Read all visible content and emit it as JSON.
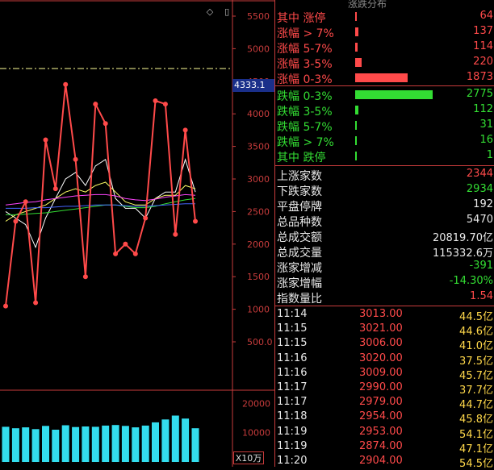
{
  "chart": {
    "price_axis": [
      "5500",
      "5000",
      "4500",
      "4000",
      "3500",
      "3000",
      "2500",
      "2000",
      "1500",
      "1000",
      "500.0"
    ],
    "volume_axis": [
      "20000",
      "10000"
    ],
    "current_price": "4333.1",
    "volume_unit": "X10万",
    "colors": {
      "up": "#ff4a4a",
      "axis": "#c83c3c",
      "ma5": "#ffffff",
      "ma10": "#ffff66",
      "ma20": "#ff44ff",
      "ma30": "#33dd33",
      "ma60": "#4466ff",
      "volume": "#33ddee"
    }
  },
  "chart_data": {
    "type": "line",
    "title": "",
    "ylabel": "",
    "ylim": [
      300,
      5700
    ],
    "series": [
      {
        "values": [
          1050,
          2350,
          2650,
          1100,
          3600,
          2850,
          4450,
          3300,
          1500,
          4150,
          3850,
          1850,
          2000,
          1850,
          2400,
          4200,
          4150,
          2150,
          3750,
          2350
        ]
      },
      {
        "values": [
          2500,
          2400,
          2300,
          1950,
          2400,
          2700,
          3000,
          3100,
          2900,
          3200,
          3300,
          2700,
          2550,
          2550,
          2400,
          2700,
          2800,
          2800,
          3300,
          2800
        ]
      },
      {
        "values": [
          2350,
          2450,
          2500,
          2550,
          2600,
          2700,
          2800,
          2850,
          2800,
          2900,
          2950,
          2800,
          2650,
          2600,
          2600,
          2700,
          2750,
          2750,
          2900,
          2850
        ]
      },
      {
        "values": [
          2600,
          2620,
          2640,
          2650,
          2680,
          2700,
          2720,
          2740,
          2750,
          2760,
          2760,
          2740,
          2700,
          2680,
          2670,
          2690,
          2720,
          2740,
          2760,
          2750
        ]
      },
      {
        "values": [
          2450,
          2450,
          2460,
          2470,
          2480,
          2500,
          2520,
          2540,
          2560,
          2580,
          2600,
          2600,
          2580,
          2560,
          2560,
          2580,
          2620,
          2650,
          2680,
          2700
        ]
      },
      {
        "values": [
          2550,
          2550,
          2550,
          2560,
          2560,
          2570,
          2580,
          2580,
          2590,
          2600,
          2600,
          2600,
          2590,
          2580,
          2580,
          2590,
          2600,
          2610,
          2620,
          2620
        ]
      }
    ],
    "volume": [
      12000,
      11500,
      11800,
      11200,
      12300,
      11000,
      12500,
      11900,
      12100,
      12000,
      12400,
      12600,
      12300,
      11800,
      12400,
      13500,
      14500,
      15800,
      14800,
      11500
    ]
  },
  "stats": {
    "header": "涨跌分布",
    "dist": [
      {
        "label": "其中 涨停",
        "value": "64",
        "color": "#ff4a4a",
        "frac": 0.02
      },
      {
        "label": "涨幅 > 7%",
        "value": "137",
        "color": "#ff4a4a",
        "frac": 0.04
      },
      {
        "label": "涨幅 5-7%",
        "value": "114",
        "color": "#ff4a4a",
        "frac": 0.03
      },
      {
        "label": "涨幅 3-5%",
        "value": "220",
        "color": "#ff4a4a",
        "frac": 0.08
      },
      {
        "label": "涨幅 0-3%",
        "value": "1873",
        "color": "#ff4a4a",
        "frac": 0.68
      },
      {
        "label": "跌幅 0-3%",
        "value": "2775",
        "color": "#33dd33",
        "frac": 1.0
      },
      {
        "label": "跌幅 3-5%",
        "value": "112",
        "color": "#33dd33",
        "frac": 0.04
      },
      {
        "label": "跌幅 5-7%",
        "value": "31",
        "color": "#33dd33",
        "frac": 0.01
      },
      {
        "label": "跌幅 > 7%",
        "value": "16",
        "color": "#33dd33",
        "frac": 0.01
      },
      {
        "label": "其中 跌停",
        "value": "1",
        "color": "#33dd33",
        "frac": 0.005
      }
    ],
    "summary": [
      {
        "label": "上涨家数",
        "value": "2344",
        "color": "#ff4a4a"
      },
      {
        "label": "下跌家数",
        "value": "2934",
        "color": "#33dd33"
      },
      {
        "label": "平盘停牌",
        "value": "192",
        "color": "#e8e8e8"
      },
      {
        "label": "总品种数",
        "value": "5470",
        "color": "#e8e8e8"
      },
      {
        "label": "总成交额",
        "value": "20819.70亿",
        "color": "#e8e8e8"
      },
      {
        "label": "总成交量",
        "value": "115332.6万",
        "color": "#e8e8e8"
      },
      {
        "label": "涨家增减",
        "value": "-391",
        "color": "#33dd33"
      },
      {
        "label": "涨家增幅",
        "value": "-14.30%",
        "color": "#33dd33"
      },
      {
        "label": "指数量比",
        "value": "1.54",
        "color": "#ff4a4a"
      }
    ],
    "ticks": [
      {
        "time": "11:14",
        "price": "3013.00",
        "amount": "44.5亿"
      },
      {
        "time": "11:15",
        "price": "3021.00",
        "amount": "44.6亿"
      },
      {
        "time": "11:15",
        "price": "3006.00",
        "amount": "41.0亿"
      },
      {
        "time": "11:16",
        "price": "3020.00",
        "amount": "37.5亿"
      },
      {
        "time": "11:16",
        "price": "3009.00",
        "amount": "45.7亿"
      },
      {
        "time": "11:17",
        "price": "2990.00",
        "amount": "37.7亿"
      },
      {
        "time": "11:17",
        "price": "2979.00",
        "amount": "44.7亿"
      },
      {
        "time": "11:18",
        "price": "2954.00",
        "amount": "45.8亿"
      },
      {
        "time": "11:19",
        "price": "2953.00",
        "amount": "54.1亿"
      },
      {
        "time": "11:19",
        "price": "2874.00",
        "amount": "47.1亿"
      },
      {
        "time": "11:20",
        "price": "2904.00",
        "amount": "54.5亿"
      }
    ]
  }
}
